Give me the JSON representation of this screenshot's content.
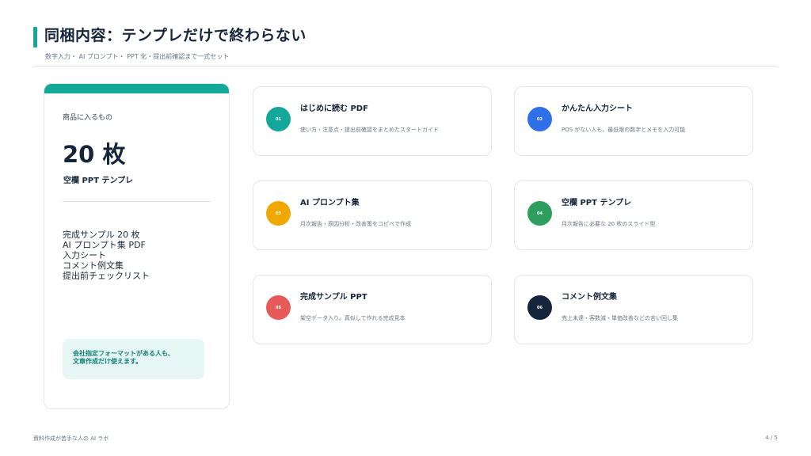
{
  "header": {
    "title": "同梱内容：テンプレだけで終わらない",
    "subtitle": "数字入力・ AI プロンプト・ PPT 化・提出前確認まで一式セット"
  },
  "panel": {
    "label": "商品に入るもの",
    "count": "20 枚",
    "name": "空欄 PPT テンプレ",
    "items": [
      "完成サンプル 20 枚",
      "AI プロンプト集 PDF",
      "入力シート",
      "コメント例文集",
      "提出前チェックリスト"
    ],
    "note_lines": [
      "会社指定フォーマットがある人も、",
      "文章作成だけ使えます。"
    ]
  },
  "cards": [
    {
      "num": "01",
      "title": "はじめに読む PDF",
      "desc": "使い方・注意点・提出前確認をまとめたスタートガイド",
      "color": "#14a89a"
    },
    {
      "num": "02",
      "title": "かんたん入力シート",
      "desc": "POS がない人も、最低限の数字とメモを入力可能",
      "color": "#2f6fe8"
    },
    {
      "num": "03",
      "title": "AI プロンプト集",
      "desc": "月次報告・原因分析・改善策をコピペで作成",
      "color": "#f0a800"
    },
    {
      "num": "04",
      "title": "空欄 PPT テンプレ",
      "desc": "月次報告に必要な 20 枚のスライド型",
      "color": "#2e9e5e"
    },
    {
      "num": "05",
      "title": "完成サンプル PPT",
      "desc": "架空データ入り。真似して作れる完成見本",
      "color": "#e85a5a"
    },
    {
      "num": "06",
      "title": "コメント例文集",
      "desc": "売上未達・客数減・単価改善などの言い回し集",
      "color": "#16263a"
    }
  ],
  "footer": {
    "left": "資料作成が苦手な人の AI ラボ",
    "right": "4 / 5"
  }
}
